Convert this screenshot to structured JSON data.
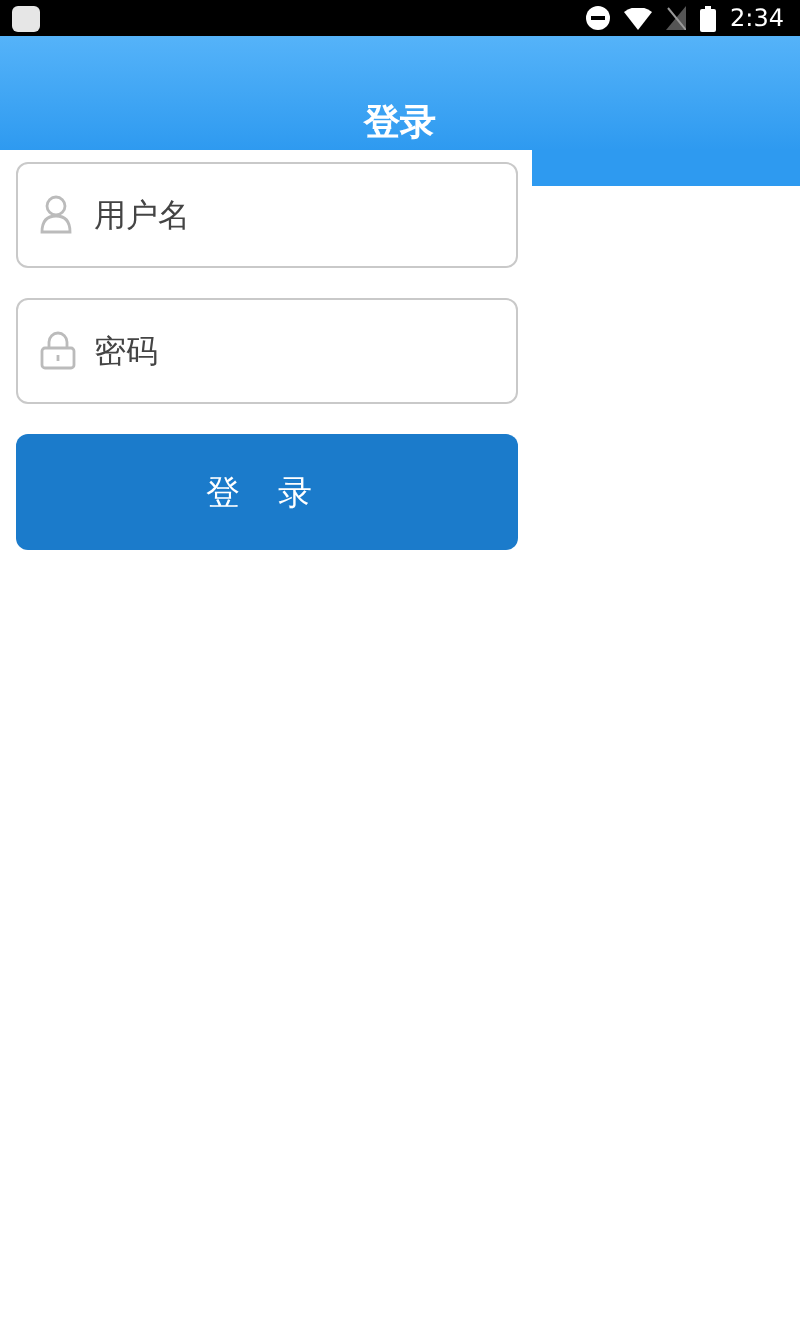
{
  "status_bar": {
    "time": "2:34"
  },
  "header": {
    "title": "登录"
  },
  "form": {
    "fields": [
      {
        "kind": "user",
        "placeholder": "用户名"
      },
      {
        "kind": "password",
        "placeholder": "密码"
      }
    ],
    "submit": "登 录"
  }
}
